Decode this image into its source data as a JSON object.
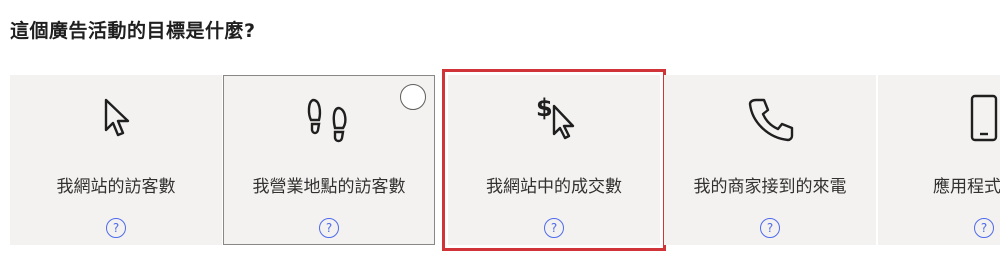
{
  "question": "這個廣告活動的目標是什麼?",
  "goals": [
    {
      "label": "我網站的訪客數",
      "icon": "cursor-arrow-icon",
      "help": "?"
    },
    {
      "label": "我營業地點的訪客數",
      "icon": "footprints-icon",
      "help": "?"
    },
    {
      "label": "我網站中的成交數",
      "icon": "dollar-cursor-icon",
      "help": "?"
    },
    {
      "label": "我的商家接到的來電",
      "icon": "phone-icon",
      "help": "?"
    },
    {
      "label": "應用程式安裝",
      "icon": "mobile-phone-icon",
      "help": "?"
    }
  ],
  "colors": {
    "card_bg": "#f3f2f1",
    "selected_outline": "#d13438",
    "help_icon": "#4f6bed"
  }
}
